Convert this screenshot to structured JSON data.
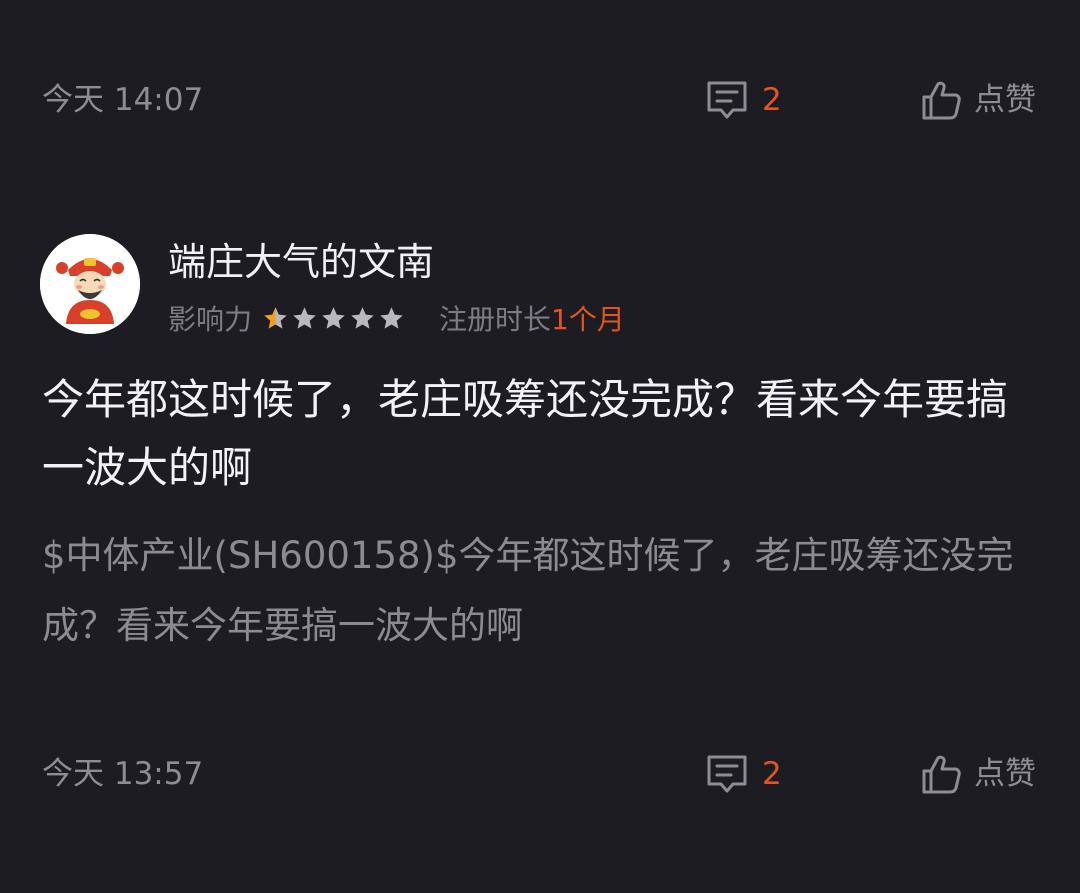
{
  "top_row": {
    "time": "今天 14:07",
    "comment_count": "2",
    "like_label": "点赞"
  },
  "post": {
    "author": {
      "name": "端庄大气的文南",
      "influence_label": "影响力",
      "influence_stars": 0.5,
      "influence_max": 5,
      "registration_label": "注册时长",
      "registration_value": "1个月"
    },
    "title": "今年都这时候了，老庄吸筹还没完成？看来今年要搞一波大的啊",
    "stock_tag": "$中体产业(SH600158)$",
    "body": "今年都这时候了，老庄吸筹还没完成？看来今年要搞一波大的啊"
  },
  "bottom_row": {
    "time": "今天 13:57",
    "comment_count": "2",
    "like_label": "点赞"
  },
  "colors": {
    "background": "#1d1c22",
    "accent": "#e2561e",
    "muted_text": "#8e8d94",
    "primary_text": "#f3f2f7",
    "star_empty": "#b9b8be"
  },
  "icons": {
    "comment": "comment-icon",
    "like": "thumbs-up-icon",
    "star": "star-icon",
    "avatar": "god-of-wealth-avatar"
  }
}
